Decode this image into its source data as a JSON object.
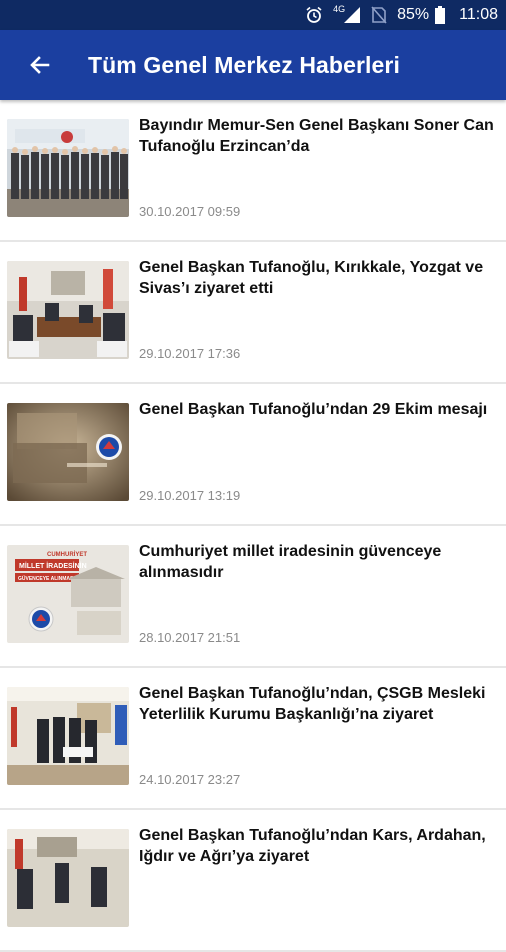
{
  "status_bar": {
    "network": "4G",
    "battery": "85%",
    "time": "11:08",
    "icons": [
      "alarm-icon",
      "signal-icon",
      "no-sim-icon",
      "battery-icon"
    ]
  },
  "header": {
    "title": "Tüm Genel Merkez Haberleri",
    "back_icon": "arrow-left-icon",
    "color": "#1b3fa0",
    "status_color": "#0f2a63"
  },
  "news": [
    {
      "title": "Bayındır Memur-Sen Genel Başkanı Soner Can Tufanoğlu Erzincan’da",
      "date": "30.10.2017 09:59"
    },
    {
      "title": "Genel Başkan Tufanoğlu, Kırıkkale, Yozgat ve Sivas’ı ziyaret etti",
      "date": "29.10.2017 17:36"
    },
    {
      "title": "Genel Başkan Tufanoğlu’ndan 29 Ekim mesajı",
      "date": "29.10.2017 13:19"
    },
    {
      "title": "Cumhuriyet millet iradesinin güvenceye alınmasıdır",
      "date": "28.10.2017 21:51",
      "image_text": [
        "CUMHURİYET",
        "MİLLET İRADESİNİN",
        "GÜVENCEYE ALINMASIDIR"
      ]
    },
    {
      "title": "Genel Başkan Tufanoğlu’ndan, ÇSGB Mesleki Yeterlilik Kurumu Başkanlığı’na ziyaret",
      "date": "24.10.2017 23:27"
    },
    {
      "title": "Genel Başkan Tufanoğlu’ndan Kars, Ardahan, Iğdır ve Ağrı’ya ziyaret",
      "date": ""
    }
  ]
}
